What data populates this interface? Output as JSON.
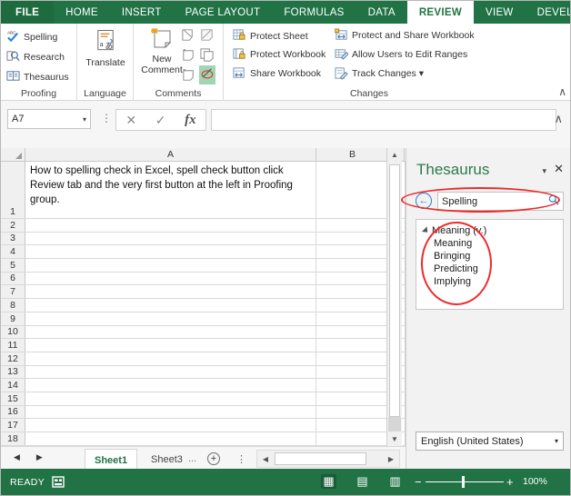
{
  "ribbon_tabs": [
    {
      "label": "FILE",
      "state": "file"
    },
    {
      "label": "HOME",
      "state": "normal"
    },
    {
      "label": "INSERT",
      "state": "normal"
    },
    {
      "label": "PAGE LAYOUT",
      "state": "normal"
    },
    {
      "label": "FORMULAS",
      "state": "normal"
    },
    {
      "label": "DATA",
      "state": "normal"
    },
    {
      "label": "REVIEW",
      "state": "active"
    },
    {
      "label": "VIEW",
      "state": "normal"
    },
    {
      "label": "DEVELOPER",
      "state": "normal"
    },
    {
      "label": "›",
      "state": "arrow"
    }
  ],
  "ribbon": {
    "proofing": {
      "group_label": "Proofing",
      "items": [
        {
          "label": "Spelling",
          "icon": "spelling-abc-check-icon"
        },
        {
          "label": "Research",
          "icon": "research-book-magnifier-icon"
        },
        {
          "label": "Thesaurus",
          "icon": "thesaurus-book-icon"
        }
      ]
    },
    "language": {
      "group_label": "Language",
      "items": [
        {
          "label": "Translate",
          "icon": "translate-icon"
        }
      ]
    },
    "comments": {
      "group_label": "Comments",
      "items": [
        {
          "label": "New Comment",
          "icon": "new-comment-icon"
        },
        {
          "label": "",
          "icon": "delete-comment-icon"
        },
        {
          "label": "",
          "icon": "previous-comment-icon"
        },
        {
          "label": "",
          "icon": "next-comment-icon"
        },
        {
          "label": "",
          "icon": "show-all-comments-icon"
        },
        {
          "label": "",
          "icon": "show-hide-comment-icon"
        },
        {
          "label": "",
          "icon": "show-ink-icon"
        }
      ]
    },
    "changes": {
      "group_label": "Changes",
      "items": [
        {
          "label": "Protect Sheet",
          "icon": "protect-sheet-icon"
        },
        {
          "label": "Protect Workbook",
          "icon": "protect-workbook-icon"
        },
        {
          "label": "Share Workbook",
          "icon": "share-workbook-icon"
        },
        {
          "label": "Protect and Share Workbook",
          "icon": "protect-share-workbook-icon"
        },
        {
          "label": "Allow Users to Edit Ranges",
          "icon": "allow-edit-ranges-icon"
        },
        {
          "label": "Track Changes ▾",
          "icon": "track-changes-icon"
        }
      ]
    },
    "collapse_icon": "∧"
  },
  "formula_bar": {
    "name_box_value": "A7",
    "name_box_caret": "▾",
    "cancel_icon": "✕",
    "enter_icon": "✓",
    "function_icon": "fx",
    "input_value": "",
    "expand_icon": "∧"
  },
  "grid": {
    "columns": [
      "A",
      "B"
    ],
    "rows": [
      1,
      2,
      3,
      4,
      5,
      6,
      7,
      8,
      9,
      10,
      11,
      12,
      13,
      14,
      15,
      16,
      17,
      18
    ],
    "cell_a1": "How to spelling check in Excel, spell check button click Review tab and the very first button at the left in Proofing group.",
    "scroll_up_icon": "▲",
    "scroll_down_icon": "▼"
  },
  "sheet_tabs": {
    "nav_prev_icon": "◀",
    "nav_next_icon": "▶",
    "tabs": [
      {
        "label": "Sheet1",
        "active": true
      },
      {
        "label": "Sheet3",
        "active": false
      }
    ],
    "overflow": "...",
    "add_sheet_icon": "⊕",
    "menu_dots": "⋮",
    "hscroll_left_icon": "◀",
    "hscroll_right_icon": "▶"
  },
  "task_pane": {
    "title": "Thesaurus",
    "caret_icon": "▾",
    "close_icon": "✕",
    "back_icon": "←",
    "search_value": "Spelling",
    "search_icon": "search-magnifier-icon",
    "results_heading": "Meaning (v.)",
    "results": [
      "Meaning",
      "Bringing",
      "Predicting",
      "Implying"
    ],
    "language_value": "English (United States)",
    "language_caret": "▾"
  },
  "status_bar": {
    "mode": "READY",
    "macro_icon": "record-macro-icon",
    "views": [
      {
        "icon": "normal-view-icon",
        "glyph": "▦",
        "active": true
      },
      {
        "icon": "page-layout-view-icon",
        "glyph": "▤",
        "active": false
      },
      {
        "icon": "page-break-view-icon",
        "glyph": "▥",
        "active": false
      }
    ],
    "zoom_out": "−",
    "zoom_in": "+",
    "zoom_value": "100%"
  },
  "annotations": {
    "color": "#ee2b2b",
    "ellipses": [
      {
        "name": "search-box-highlight"
      },
      {
        "name": "results-list-highlight"
      }
    ]
  }
}
